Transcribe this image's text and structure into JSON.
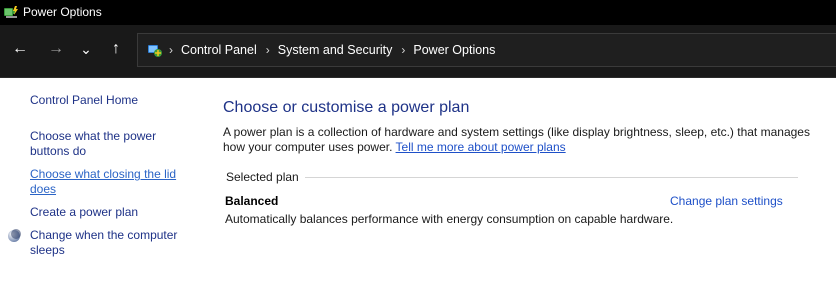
{
  "window": {
    "title": "Power Options",
    "icon": "power-options-icon"
  },
  "nav": {
    "back_icon": "arrow-left-icon",
    "forward_icon": "arrow-right-icon",
    "recent_icon": "chevron-down-icon",
    "up_icon": "arrow-up-icon",
    "glyphs": {
      "back": "←",
      "forward": "→",
      "recent": "⌄",
      "up": "↑",
      "sep": "›"
    }
  },
  "address": {
    "icon": "control-panel-icon",
    "breadcrumbs": [
      "Control Panel",
      "System and Security",
      "Power Options"
    ]
  },
  "sidebar": {
    "items": [
      {
        "label": "Control Panel Home"
      },
      {
        "label": "Choose what the power buttons do"
      },
      {
        "label": "Choose what closing the lid does",
        "active": true
      },
      {
        "label": "Create a power plan"
      },
      {
        "label": "Change when the computer sleeps",
        "icon": "moon-icon"
      }
    ]
  },
  "main": {
    "heading": "Choose or customise a power plan",
    "description": "A power plan is a collection of hardware and system settings (like display brightness, sleep, etc.) that manages how your computer uses power.",
    "learn_more": "Tell me more about power plans",
    "selected_plan_label": "Selected plan",
    "plan": {
      "name": "Balanced",
      "description": "Automatically balances performance with energy consumption on capable hardware.",
      "settings_link": "Change plan settings"
    }
  },
  "colors": {
    "titlebar_bg": "#000000",
    "navbar_bg": "#191919",
    "link_dark": "#1e3287",
    "link_blue": "#1e50c8",
    "link_active": "#2b64c6"
  }
}
